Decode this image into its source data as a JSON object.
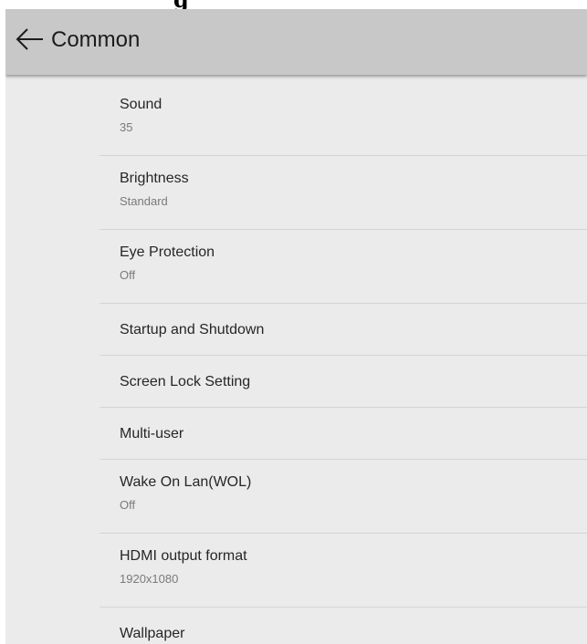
{
  "page_heading_partial": "g",
  "header": {
    "back_icon": "arrow-left-icon",
    "title": "Common",
    "background": "#c8c8c8"
  },
  "settings": [
    {
      "title": "Sound",
      "value": "35"
    },
    {
      "title": "Brightness",
      "value": "Standard"
    },
    {
      "title": "Eye Protection",
      "value": "Off"
    },
    {
      "title": "Startup and Shutdown"
    },
    {
      "title": "Screen Lock Setting"
    },
    {
      "title": "Multi-user"
    },
    {
      "title": "Wake On Lan(WOL)",
      "value": "Off"
    },
    {
      "title": "HDMI output format",
      "value": "1920x1080"
    },
    {
      "title": "Wallpaper"
    }
  ]
}
